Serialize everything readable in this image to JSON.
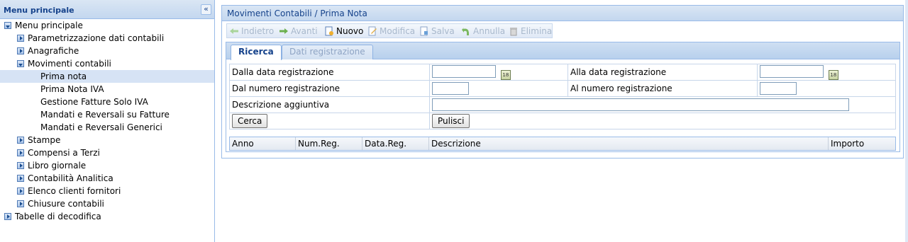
{
  "sidebar": {
    "title": "Menu principale",
    "collapse_glyph": "«",
    "tree": [
      {
        "label": "Menu principale",
        "level": 0,
        "icon": "open"
      },
      {
        "label": "Parametrizzazione dati contabili",
        "level": 1,
        "icon": "closed"
      },
      {
        "label": "Anagrafiche",
        "level": 1,
        "icon": "closed"
      },
      {
        "label": "Movimenti contabili",
        "level": 1,
        "icon": "open"
      },
      {
        "label": "Prima nota",
        "level": 2,
        "icon": "none",
        "selected": true
      },
      {
        "label": "Prima Nota IVA",
        "level": 2,
        "icon": "none"
      },
      {
        "label": "Gestione Fatture Solo IVA",
        "level": 2,
        "icon": "none"
      },
      {
        "label": "Mandati e Reversali su Fatture",
        "level": 2,
        "icon": "none"
      },
      {
        "label": "Mandati e Reversali Generici",
        "level": 2,
        "icon": "none"
      },
      {
        "label": "Stampe",
        "level": 1,
        "icon": "closed"
      },
      {
        "label": "Compensi a Terzi",
        "level": 1,
        "icon": "closed"
      },
      {
        "label": "Libro giornale",
        "level": 1,
        "icon": "closed"
      },
      {
        "label": "Contabilità Analitica",
        "level": 1,
        "icon": "closed"
      },
      {
        "label": "Elenco clienti fornitori",
        "level": 1,
        "icon": "closed"
      },
      {
        "label": "Chiusure contabili",
        "level": 1,
        "icon": "closed"
      },
      {
        "label": "Tabelle di decodifica",
        "level": 0,
        "icon": "closed"
      }
    ]
  },
  "main": {
    "title": "Movimenti Contabili / Prima Nota",
    "toolbar": {
      "back": "Indietro",
      "forward": "Avanti",
      "new": "Nuovo",
      "edit": "Modifica",
      "save": "Salva",
      "cancel": "Annulla",
      "delete": "Elimina"
    },
    "tabs": {
      "search": "Ricerca",
      "data": "Dati registrazione"
    },
    "form": {
      "from_date_label": "Dalla data registrazione",
      "to_date_label": "Alla data registrazione",
      "from_number_label": "Dal numero registrazione",
      "to_number_label": "Al numero registrazione",
      "description_label": "Descrizione aggiuntiva",
      "from_date_value": "",
      "to_date_value": "",
      "from_number_value": "",
      "to_number_value": "",
      "description_value": "",
      "search_button": "Cerca",
      "clear_button": "Pulisci",
      "calendar_glyph": "18"
    },
    "grid": {
      "columns": [
        "Anno",
        "Num.Reg.",
        "Data.Reg.",
        "Descrizione",
        "Importo"
      ]
    }
  },
  "colors": {
    "header_text": "#15428b",
    "border": "#99bbe8",
    "selected_row": "#d6e3f5",
    "disabled_text": "#a8b8cc"
  }
}
